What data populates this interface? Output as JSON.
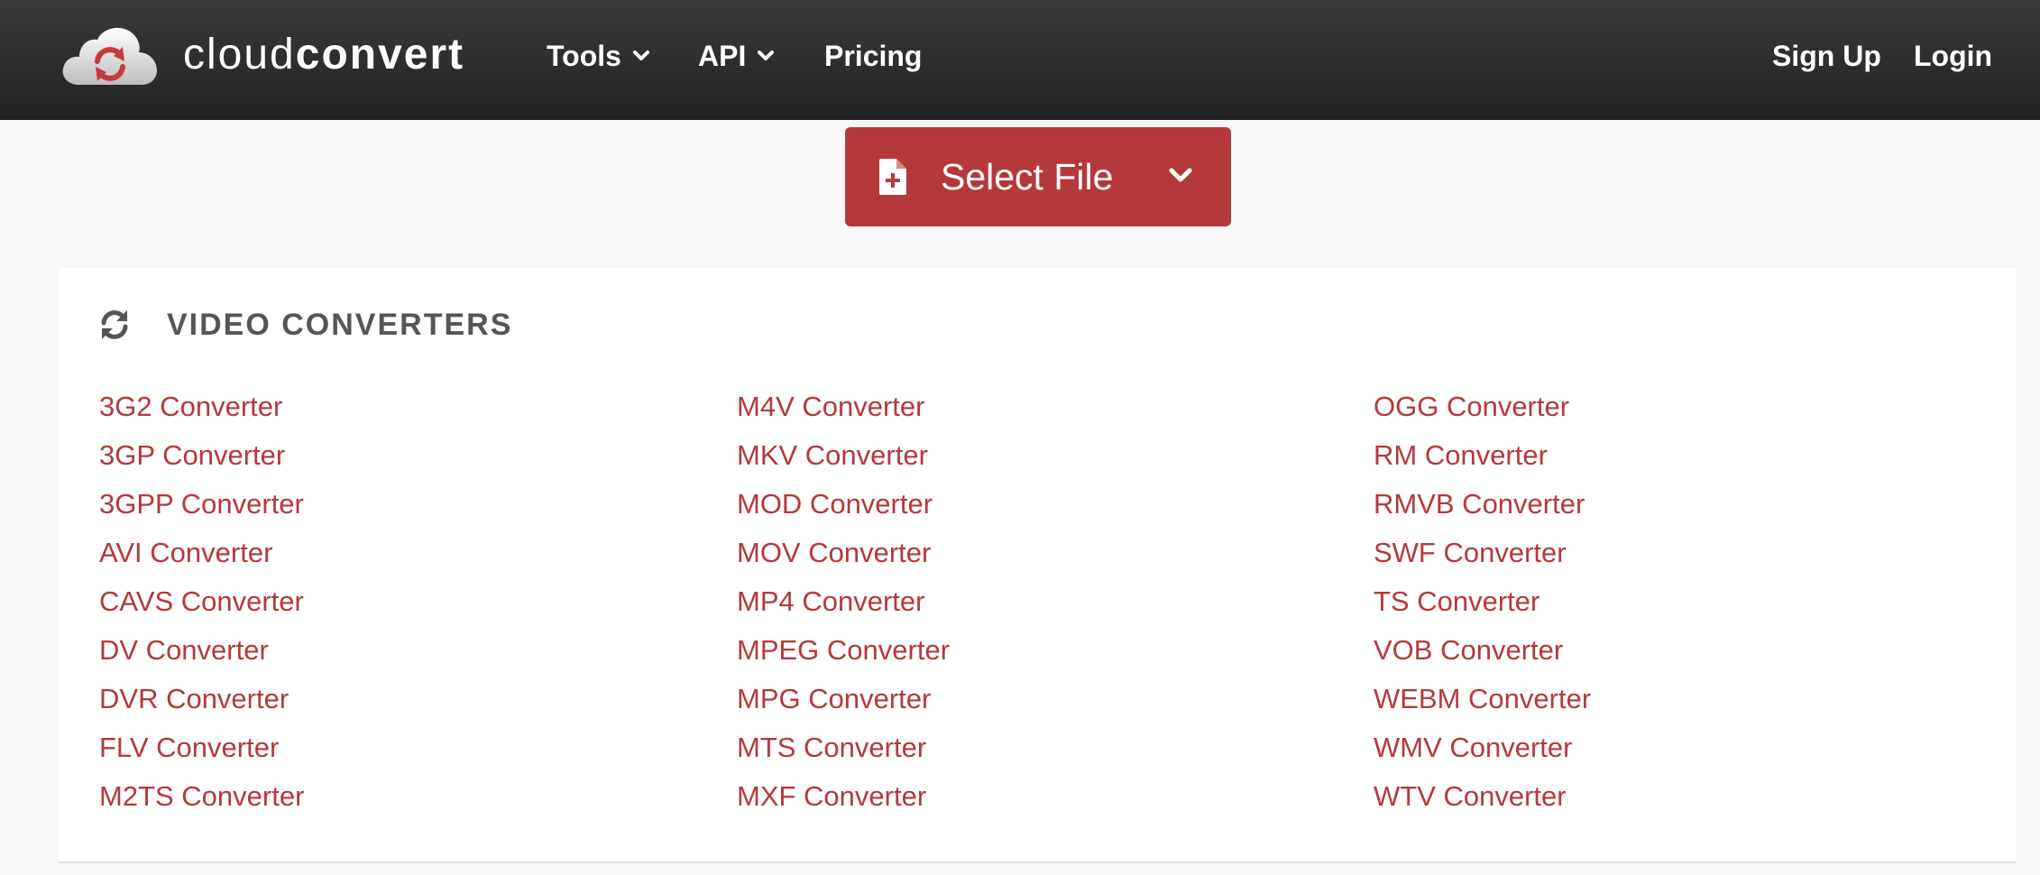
{
  "brand": {
    "name_light": "cloud",
    "name_bold": "convert",
    "accent_color": "#b5393a",
    "logo_icon": "cloud-refresh-icon"
  },
  "nav": {
    "tools_label": "Tools",
    "api_label": "API",
    "pricing_label": "Pricing",
    "signup_label": "Sign Up",
    "login_label": "Login"
  },
  "select_file": {
    "label": "Select File",
    "icon": "file-plus-icon"
  },
  "section": {
    "title": "VIDEO CONVERTERS",
    "icon": "refresh-icon",
    "columns": [
      [
        "3G2 Converter",
        "3GP Converter",
        "3GPP Converter",
        "AVI Converter",
        "CAVS Converter",
        "DV Converter",
        "DVR Converter",
        "FLV Converter",
        "M2TS Converter"
      ],
      [
        "M4V Converter",
        "MKV Converter",
        "MOD Converter",
        "MOV Converter",
        "MP4 Converter",
        "MPEG Converter",
        "MPG Converter",
        "MTS Converter",
        "MXF Converter"
      ],
      [
        "OGG Converter",
        "RM Converter",
        "RMVB Converter",
        "SWF Converter",
        "TS Converter",
        "VOB Converter",
        "WEBM Converter",
        "WMV Converter",
        "WTV Converter"
      ]
    ]
  }
}
